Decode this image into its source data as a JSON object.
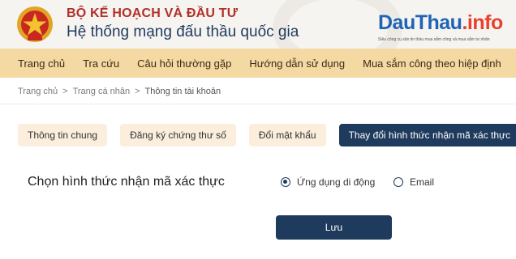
{
  "header": {
    "org_line1": "BỘ KẾ HOẠCH VÀ ĐẦU TƯ",
    "org_line2": "Hệ thống mạng đấu thầu quốc gia",
    "brand_part1": "DauThau",
    "brand_part2": ".info",
    "brand_tagline": "Siêu công cụ săn tin thầu mua sắm công và mua sắm tư nhân"
  },
  "nav": {
    "items": [
      "Trang chủ",
      "Tra cứu",
      "Câu hỏi thường gặp",
      "Hướng dẫn sử dụng",
      "Mua sắm công theo hiệp định"
    ]
  },
  "breadcrumb": {
    "items": [
      "Trang chủ",
      "Trang cá nhân",
      "Thông tin tài khoản"
    ],
    "separator": ">"
  },
  "tabs": {
    "items": [
      "Thông tin chung",
      "Đăng ký chứng thư số",
      "Đổi mật khẩu",
      "Thay đổi hình thức nhận mã xác thực"
    ],
    "active_index": 3
  },
  "form": {
    "label": "Chọn hình thức nhận mã xác thực",
    "options": [
      "Ứng dụng di động",
      "Email"
    ],
    "selected_index": 0,
    "save_label": "Lưu"
  },
  "colors": {
    "nav_bg": "#f5d9a3",
    "tab_bg": "#fbeedd",
    "primary": "#1e3a5c",
    "brand_blue": "#1e63b5",
    "brand_red": "#e8412c",
    "org_red": "#b0302a"
  },
  "icons": {
    "emblem": "national-emblem-icon"
  }
}
